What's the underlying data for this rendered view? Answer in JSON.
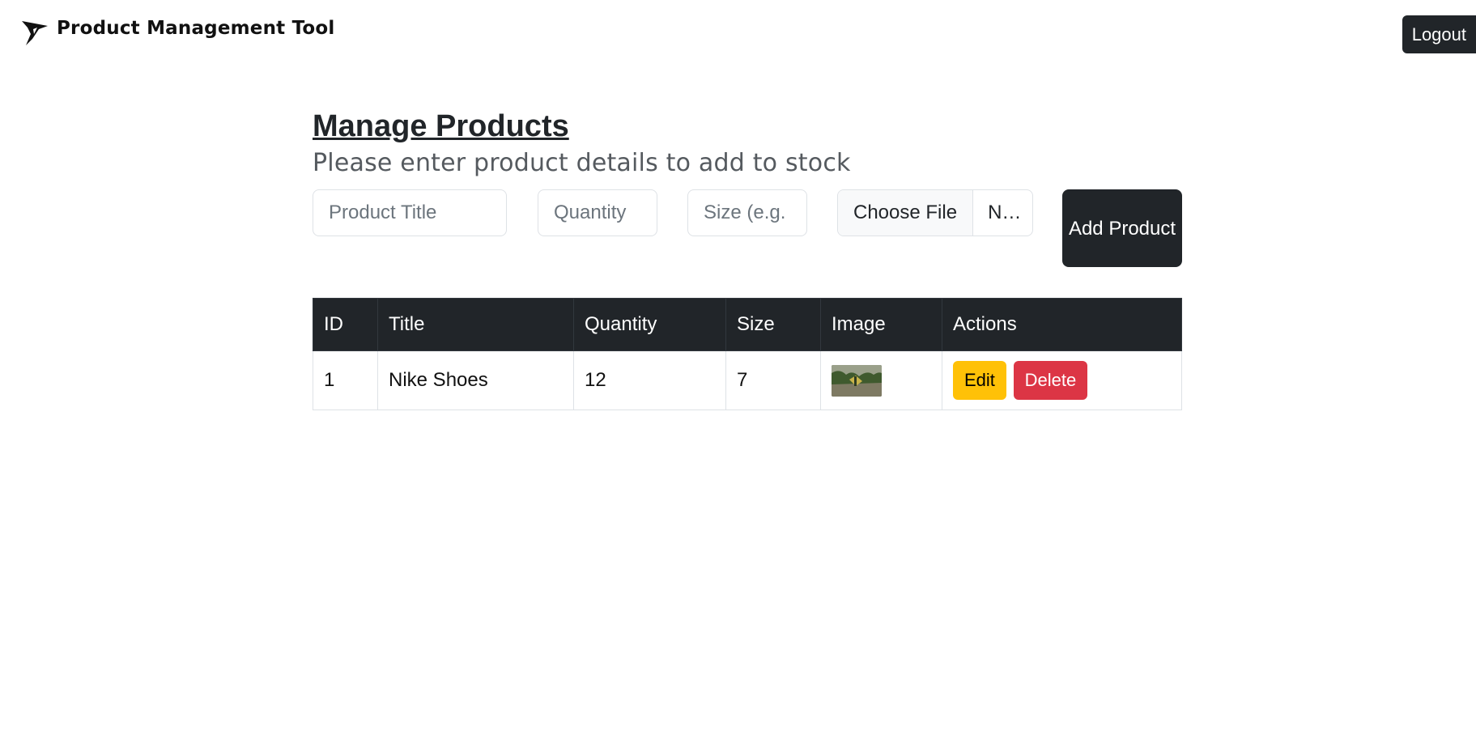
{
  "header": {
    "brand_title": "Product Management Tool",
    "logo_icon": "bird-logo-icon",
    "logout_label": "Logout"
  },
  "main": {
    "title": "Manage Products",
    "subtitle": "Please enter product details to add to stock"
  },
  "form": {
    "title_placeholder": "Product Title",
    "quantity_placeholder": "Quantity",
    "size_placeholder": "Size (e.g.",
    "file_button_label": "Choose File",
    "file_name": "N…",
    "add_button_label": "Add Product"
  },
  "table": {
    "columns": [
      "ID",
      "Title",
      "Quantity",
      "Size",
      "Image",
      "Actions"
    ],
    "rows": [
      {
        "id": "1",
        "title": "Nike Shoes",
        "quantity": "12",
        "size": "7",
        "image_alt": "product-thumbnail",
        "edit_label": "Edit",
        "delete_label": "Delete"
      }
    ]
  },
  "colors": {
    "dark": "#212529",
    "edit": "#ffc107",
    "delete": "#dc3545"
  }
}
